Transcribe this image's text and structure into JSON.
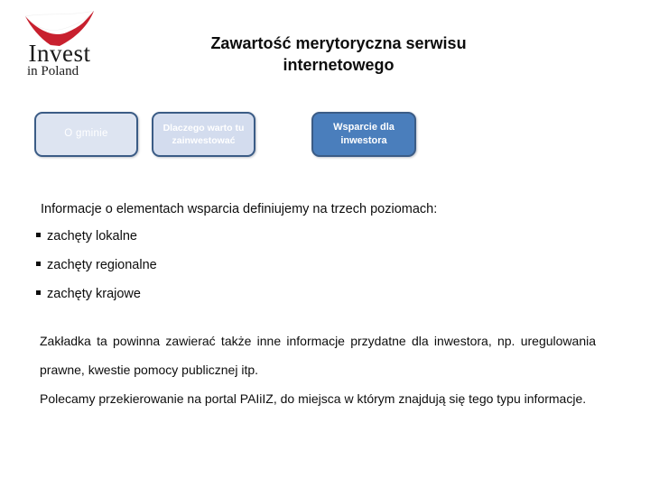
{
  "logo": {
    "name": "invest-in-poland-logo",
    "primary_text": "Invest",
    "secondary_text": "in Poland",
    "flag_red": "#c8202e",
    "flag_white": "#ffffff"
  },
  "title": {
    "line1": "Zawartość merytoryczna serwisu",
    "line2": "internetowego"
  },
  "tabs": [
    {
      "label": "O gminie",
      "state": "inactive",
      "fill": "#dde4f1",
      "border": "#3b5c86",
      "text_color": "#ffffff"
    },
    {
      "label": "Dlaczego warto tu zainwestować",
      "state": "inactive",
      "fill": "#d3dcee",
      "border": "#3b5c86",
      "text_color": "#ffffff"
    },
    {
      "label": "Wsparcie dla inwestora",
      "state": "active",
      "fill": "#4a7ebc",
      "border": "#3b5c86",
      "text_color": "#ffffff"
    }
  ],
  "content": {
    "lead": "Informacje o elementach wsparcia definiujemy na trzech poziomach:",
    "bullets": [
      "zachęty lokalne",
      "zachęty regionalne",
      "zachęty krajowe"
    ],
    "paragraphs": [
      "Zakładka ta powinna  zawierać także inne informacje przydatne dla inwestora, np. uregulowania prawne, kwestie pomocy publicznej itp.",
      "Polecamy przekierowanie na portal PAIiIZ, do miejsca w którym znajdują się tego typu informacje."
    ]
  }
}
